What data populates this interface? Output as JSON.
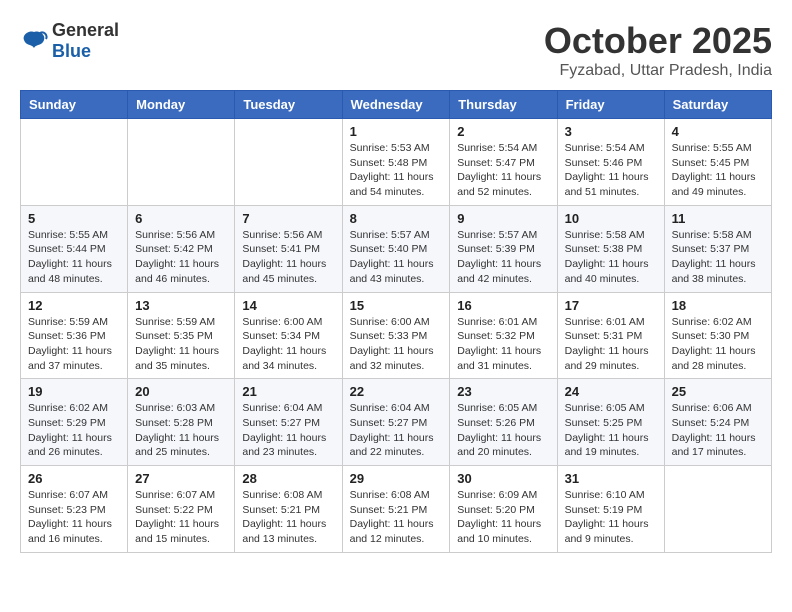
{
  "logo": {
    "general": "General",
    "blue": "Blue"
  },
  "title": "October 2025",
  "location": "Fyzabad, Uttar Pradesh, India",
  "days_of_week": [
    "Sunday",
    "Monday",
    "Tuesday",
    "Wednesday",
    "Thursday",
    "Friday",
    "Saturday"
  ],
  "weeks": [
    [
      {
        "day": "",
        "info": ""
      },
      {
        "day": "",
        "info": ""
      },
      {
        "day": "",
        "info": ""
      },
      {
        "day": "1",
        "info": "Sunrise: 5:53 AM\nSunset: 5:48 PM\nDaylight: 11 hours and 54 minutes."
      },
      {
        "day": "2",
        "info": "Sunrise: 5:54 AM\nSunset: 5:47 PM\nDaylight: 11 hours and 52 minutes."
      },
      {
        "day": "3",
        "info": "Sunrise: 5:54 AM\nSunset: 5:46 PM\nDaylight: 11 hours and 51 minutes."
      },
      {
        "day": "4",
        "info": "Sunrise: 5:55 AM\nSunset: 5:45 PM\nDaylight: 11 hours and 49 minutes."
      }
    ],
    [
      {
        "day": "5",
        "info": "Sunrise: 5:55 AM\nSunset: 5:44 PM\nDaylight: 11 hours and 48 minutes."
      },
      {
        "day": "6",
        "info": "Sunrise: 5:56 AM\nSunset: 5:42 PM\nDaylight: 11 hours and 46 minutes."
      },
      {
        "day": "7",
        "info": "Sunrise: 5:56 AM\nSunset: 5:41 PM\nDaylight: 11 hours and 45 minutes."
      },
      {
        "day": "8",
        "info": "Sunrise: 5:57 AM\nSunset: 5:40 PM\nDaylight: 11 hours and 43 minutes."
      },
      {
        "day": "9",
        "info": "Sunrise: 5:57 AM\nSunset: 5:39 PM\nDaylight: 11 hours and 42 minutes."
      },
      {
        "day": "10",
        "info": "Sunrise: 5:58 AM\nSunset: 5:38 PM\nDaylight: 11 hours and 40 minutes."
      },
      {
        "day": "11",
        "info": "Sunrise: 5:58 AM\nSunset: 5:37 PM\nDaylight: 11 hours and 38 minutes."
      }
    ],
    [
      {
        "day": "12",
        "info": "Sunrise: 5:59 AM\nSunset: 5:36 PM\nDaylight: 11 hours and 37 minutes."
      },
      {
        "day": "13",
        "info": "Sunrise: 5:59 AM\nSunset: 5:35 PM\nDaylight: 11 hours and 35 minutes."
      },
      {
        "day": "14",
        "info": "Sunrise: 6:00 AM\nSunset: 5:34 PM\nDaylight: 11 hours and 34 minutes."
      },
      {
        "day": "15",
        "info": "Sunrise: 6:00 AM\nSunset: 5:33 PM\nDaylight: 11 hours and 32 minutes."
      },
      {
        "day": "16",
        "info": "Sunrise: 6:01 AM\nSunset: 5:32 PM\nDaylight: 11 hours and 31 minutes."
      },
      {
        "day": "17",
        "info": "Sunrise: 6:01 AM\nSunset: 5:31 PM\nDaylight: 11 hours and 29 minutes."
      },
      {
        "day": "18",
        "info": "Sunrise: 6:02 AM\nSunset: 5:30 PM\nDaylight: 11 hours and 28 minutes."
      }
    ],
    [
      {
        "day": "19",
        "info": "Sunrise: 6:02 AM\nSunset: 5:29 PM\nDaylight: 11 hours and 26 minutes."
      },
      {
        "day": "20",
        "info": "Sunrise: 6:03 AM\nSunset: 5:28 PM\nDaylight: 11 hours and 25 minutes."
      },
      {
        "day": "21",
        "info": "Sunrise: 6:04 AM\nSunset: 5:27 PM\nDaylight: 11 hours and 23 minutes."
      },
      {
        "day": "22",
        "info": "Sunrise: 6:04 AM\nSunset: 5:27 PM\nDaylight: 11 hours and 22 minutes."
      },
      {
        "day": "23",
        "info": "Sunrise: 6:05 AM\nSunset: 5:26 PM\nDaylight: 11 hours and 20 minutes."
      },
      {
        "day": "24",
        "info": "Sunrise: 6:05 AM\nSunset: 5:25 PM\nDaylight: 11 hours and 19 minutes."
      },
      {
        "day": "25",
        "info": "Sunrise: 6:06 AM\nSunset: 5:24 PM\nDaylight: 11 hours and 17 minutes."
      }
    ],
    [
      {
        "day": "26",
        "info": "Sunrise: 6:07 AM\nSunset: 5:23 PM\nDaylight: 11 hours and 16 minutes."
      },
      {
        "day": "27",
        "info": "Sunrise: 6:07 AM\nSunset: 5:22 PM\nDaylight: 11 hours and 15 minutes."
      },
      {
        "day": "28",
        "info": "Sunrise: 6:08 AM\nSunset: 5:21 PM\nDaylight: 11 hours and 13 minutes."
      },
      {
        "day": "29",
        "info": "Sunrise: 6:08 AM\nSunset: 5:21 PM\nDaylight: 11 hours and 12 minutes."
      },
      {
        "day": "30",
        "info": "Sunrise: 6:09 AM\nSunset: 5:20 PM\nDaylight: 11 hours and 10 minutes."
      },
      {
        "day": "31",
        "info": "Sunrise: 6:10 AM\nSunset: 5:19 PM\nDaylight: 11 hours and 9 minutes."
      },
      {
        "day": "",
        "info": ""
      }
    ]
  ]
}
